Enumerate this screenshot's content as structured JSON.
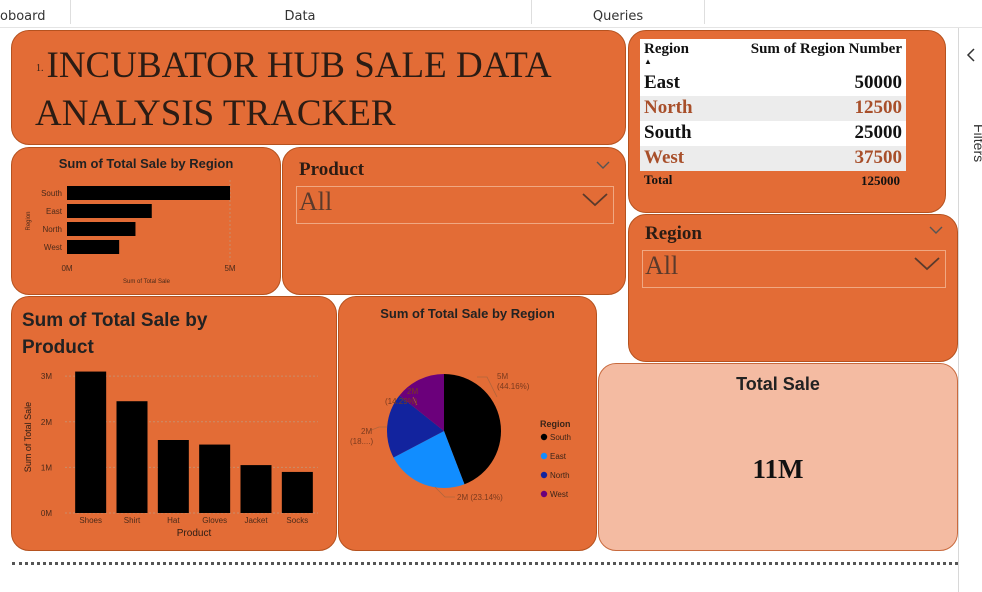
{
  "ribbon": {
    "tabs": [
      "oboard",
      "Data",
      "Queries"
    ]
  },
  "title": {
    "number": "1.",
    "line1": "INCUBATOR HUB SALE DATA",
    "line2": "ANALYSIS TRACKER"
  },
  "region_table": {
    "headers": [
      "Region",
      "Sum of Region Number"
    ],
    "rows": [
      {
        "region": "East",
        "value": "50000"
      },
      {
        "region": "North",
        "value": "12500"
      },
      {
        "region": "South",
        "value": "25000"
      },
      {
        "region": "West",
        "value": "37500"
      }
    ],
    "total_label": "Total",
    "total_value": "125000"
  },
  "product_slicer": {
    "title": "Product",
    "value": "All"
  },
  "region_slicer": {
    "title": "Region",
    "value": "All"
  },
  "total_sale": {
    "label": "Total Sale",
    "value": "11M"
  },
  "filter_pane": {
    "label": "Filters"
  },
  "colors": {
    "tile": "#e36c36",
    "card": "#f4bba2",
    "bar": "#000000",
    "south": "#000000",
    "east": "#118dff",
    "north": "#12239e",
    "west": "#6b007b"
  },
  "chart_data": [
    {
      "type": "bar",
      "orientation": "horizontal",
      "title": "Sum of Total Sale by Region",
      "categories": [
        "South",
        "East",
        "North",
        "West"
      ],
      "values": [
        5.0,
        2.6,
        2.1,
        1.6
      ],
      "unit": "M",
      "xlabel": "Sum of Total Sale",
      "ylabel": "Region",
      "xticks": [
        "0M",
        "5M"
      ],
      "xlim": [
        0,
        5
      ]
    },
    {
      "type": "bar",
      "title": "Sum of Total Sale by Product",
      "categories": [
        "Shoes",
        "Shirt",
        "Hat",
        "Gloves",
        "Jacket",
        "Socks"
      ],
      "values": [
        3.1,
        2.45,
        1.6,
        1.5,
        1.05,
        0.9
      ],
      "unit": "M",
      "xlabel": "Product",
      "ylabel": "Sum of Total Sale",
      "yticks": [
        "0M",
        "1M",
        "2M",
        "3M"
      ],
      "ylim": [
        0,
        3.2
      ]
    },
    {
      "type": "pie",
      "title": "Sum of Total Sale by Region",
      "legend_title": "Region",
      "slices": [
        {
          "name": "South",
          "value": 44.16,
          "label": "5M",
          "pct": "(44.16%)",
          "color": "#000000"
        },
        {
          "name": "East",
          "value": 23.14,
          "label": "2M (23.14%)",
          "color": "#118dff"
        },
        {
          "name": "North",
          "value": 18.41,
          "label": "2M",
          "pct": "(18....)",
          "color": "#12239e"
        },
        {
          "name": "West",
          "value": 14.29,
          "label": "2M",
          "pct": "(14.29%)",
          "color": "#6b007b"
        }
      ]
    }
  ]
}
